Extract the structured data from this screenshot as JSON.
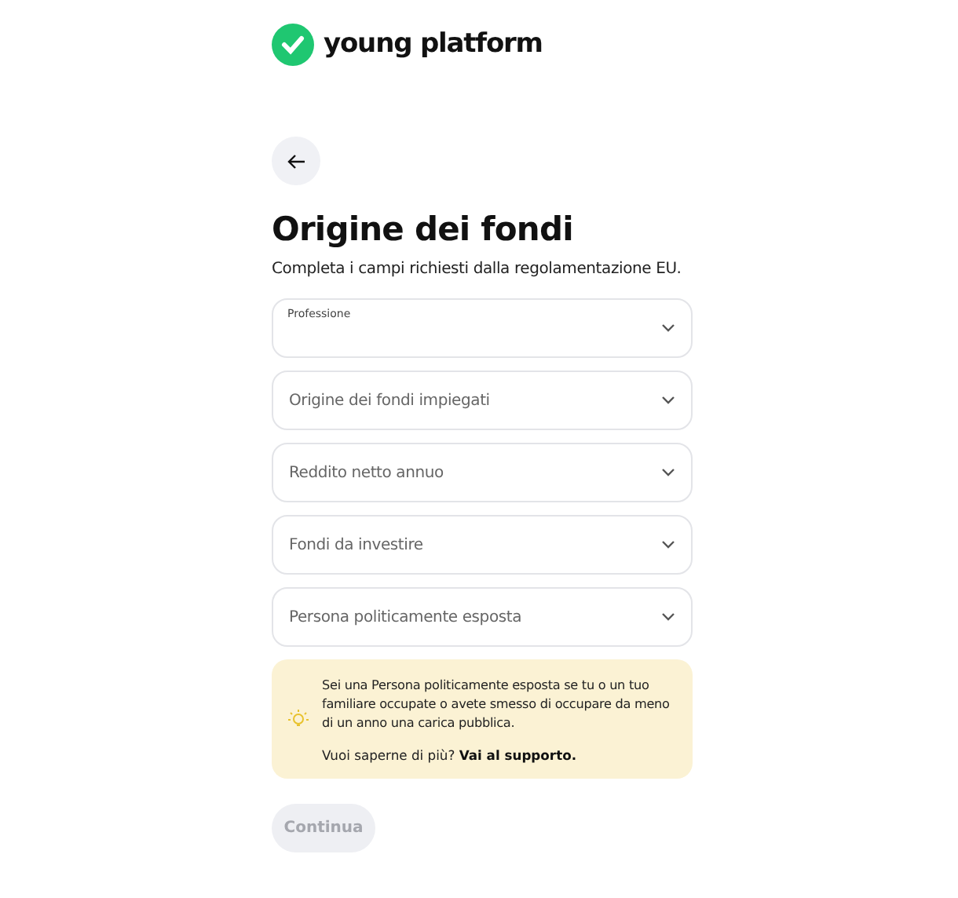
{
  "logo": {
    "text": "young platform"
  },
  "title": "Origine dei fondi",
  "subtitle": "Completa i campi richiesti dalla regolamentazione EU.",
  "fields": [
    {
      "kind": "floating",
      "label": "Professione"
    },
    {
      "kind": "placeholder",
      "placeholder": "Origine dei fondi impiegati"
    },
    {
      "kind": "placeholder",
      "placeholder": "Reddito netto annuo"
    },
    {
      "kind": "placeholder",
      "placeholder": "Fondi da investire"
    },
    {
      "kind": "placeholder",
      "placeholder": "Persona politicamente esposta"
    }
  ],
  "notice": {
    "text": "Sei una Persona politicamente esposta se tu o un tuo familiare occupate o avete smesso di occupare da meno di un anno una carica pubblica.",
    "question": "Vuoi saperne di più?",
    "link": "Vai al supporto."
  },
  "continue_button": {
    "label": "Continua",
    "disabled": true
  }
}
